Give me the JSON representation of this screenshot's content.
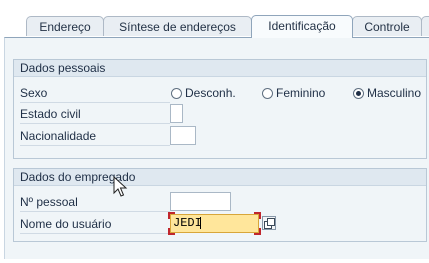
{
  "tabs": [
    {
      "label": "Endereço",
      "active": false
    },
    {
      "label": "Síntese de endereços",
      "active": false
    },
    {
      "label": "Identificação",
      "active": true
    },
    {
      "label": "Controle",
      "active": false
    },
    {
      "label": "",
      "active": false
    }
  ],
  "personal": {
    "title": "Dados pessoais",
    "sexo_label": "Sexo",
    "sexo_options": [
      {
        "label": "Desconh.",
        "checked": false
      },
      {
        "label": "Feminino",
        "checked": false
      },
      {
        "label": "Masculino",
        "checked": true
      }
    ],
    "estado_civil_label": "Estado civil",
    "estado_civil_value": "",
    "nacionalidade_label": "Nacionalidade",
    "nacionalidade_value": ""
  },
  "employee": {
    "title": "Dados do empregado",
    "n_pessoal_label": "Nº pessoal",
    "n_pessoal_value": "",
    "usuario_label": "Nome do usuário",
    "usuario_value": "JEDI"
  },
  "colors": {
    "focus_field": "#ffe69b",
    "focus_corner": "#c0262d",
    "group_header": "#dfe8f0",
    "panel": "#f0f5f8"
  },
  "icons": [
    "possible-entries-icon",
    "mouse-pointer-icon"
  ]
}
